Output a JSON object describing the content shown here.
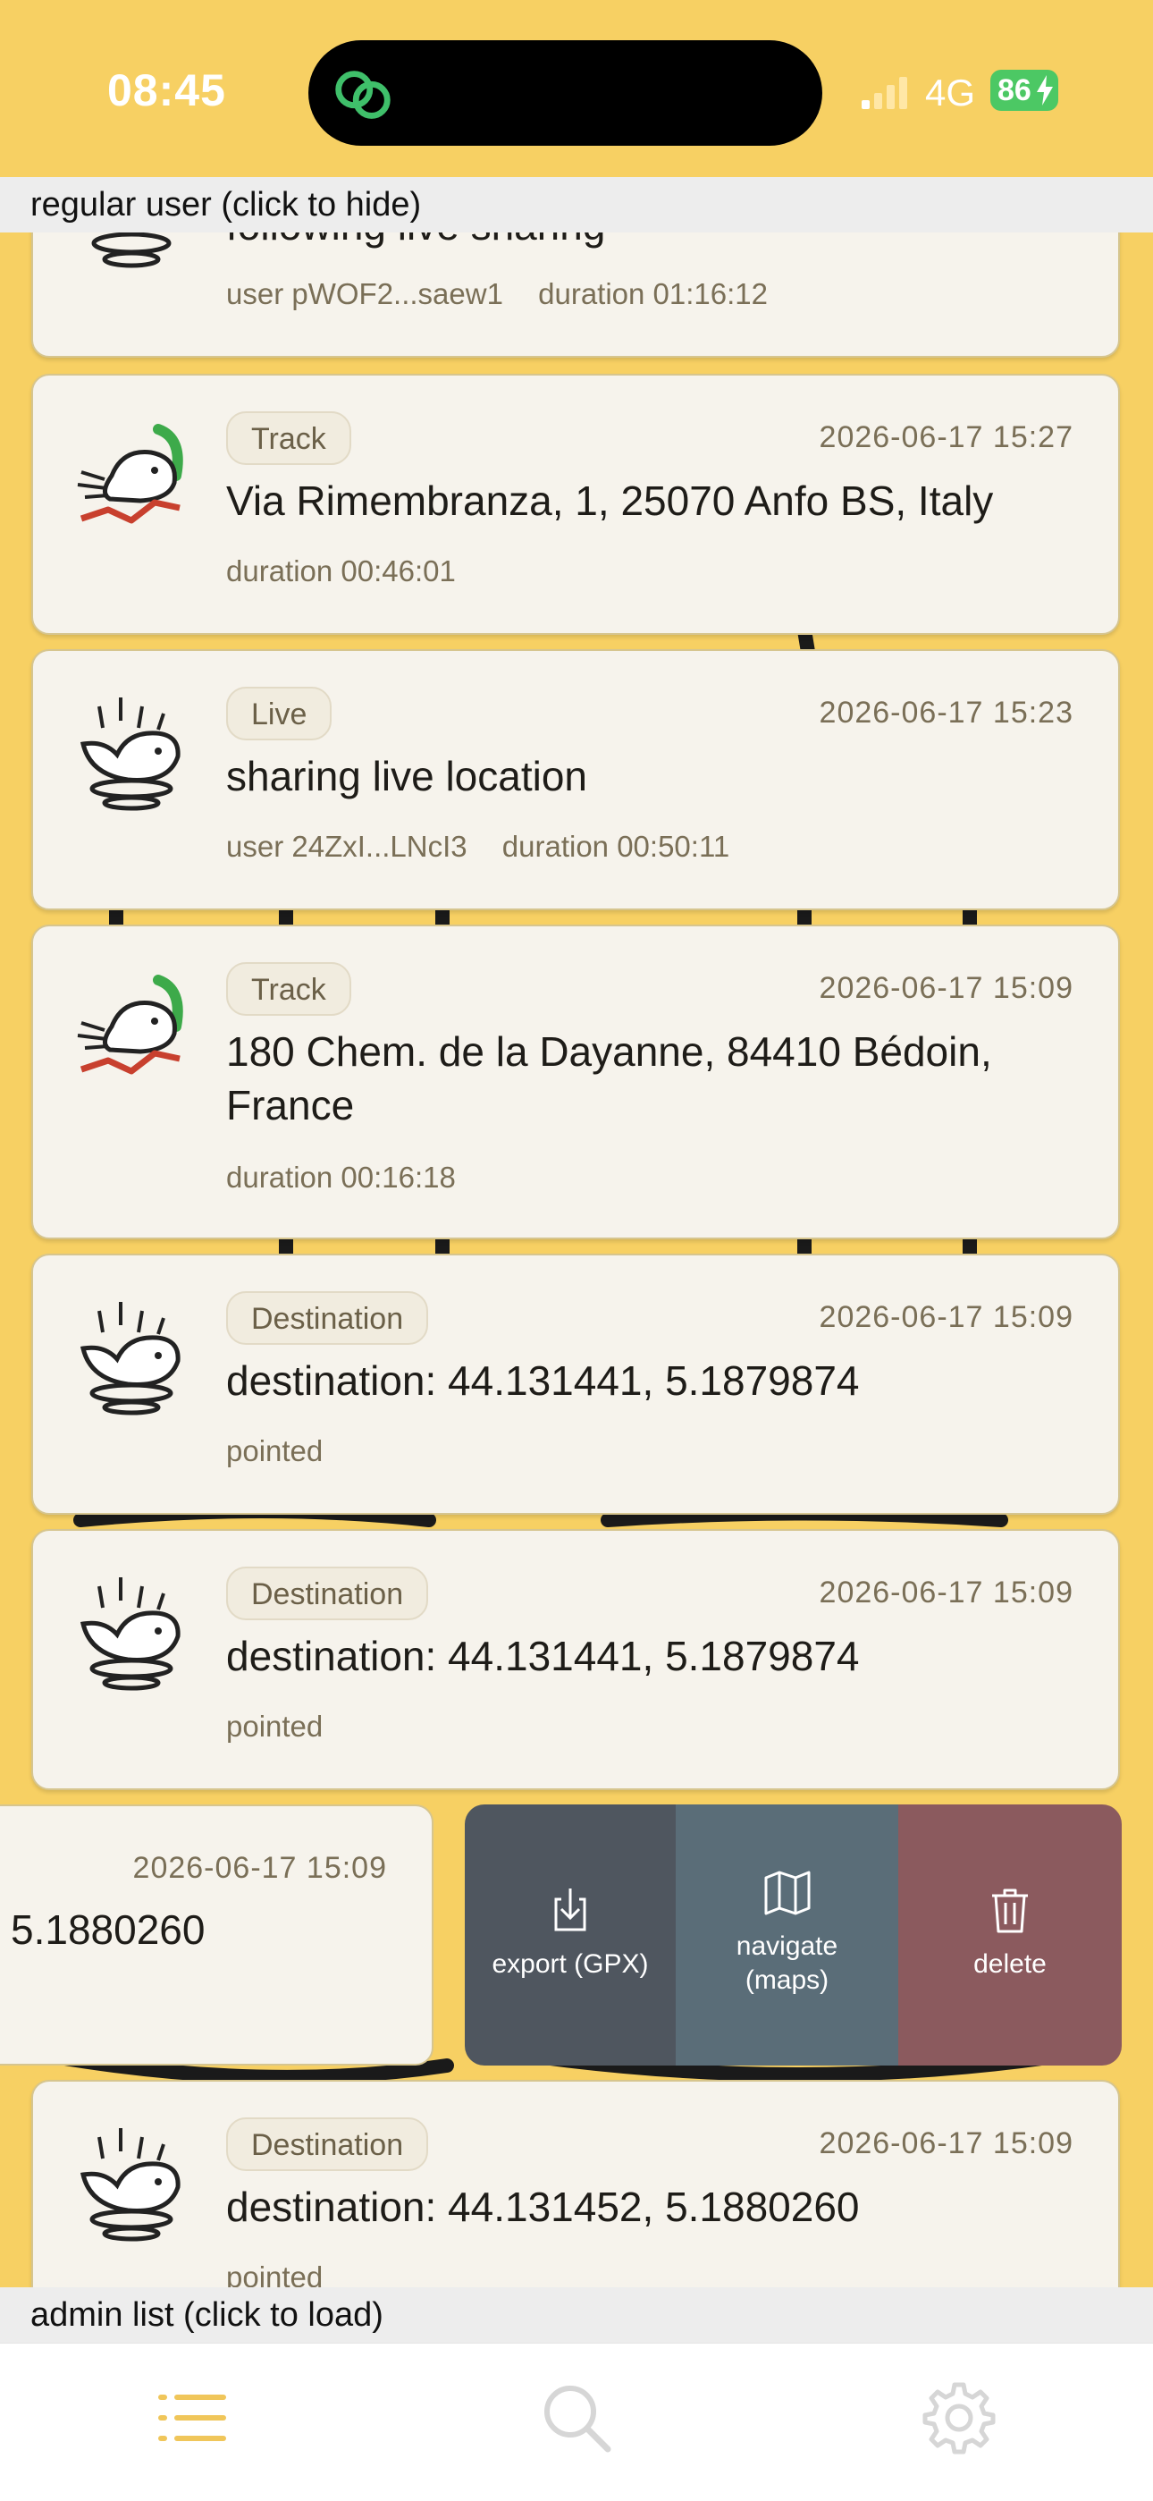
{
  "status_bar": {
    "time": "08:45",
    "network": "4G",
    "battery": "86",
    "island_icon": "link-rings-icon"
  },
  "banners": {
    "top": "regular user (click to hide)",
    "bottom": "admin list (click to load)"
  },
  "items": [
    {
      "type_label": "",
      "date": "",
      "title": "following live sharing",
      "meta": [
        "user pWOF2...saew1",
        "duration 01:16:12"
      ],
      "icon": "whale-splash-icon"
    },
    {
      "type_label": "Track",
      "date": "2026-06-17 15:27",
      "title": "Via Rimembranza, 1, 25070 Anfo BS, Italy",
      "meta": [
        "duration 00:46:01"
      ],
      "icon": "whale-track-icon"
    },
    {
      "type_label": "Live",
      "date": "2026-06-17 15:23",
      "title": "sharing live location",
      "meta": [
        "user 24ZxI...LNcI3",
        "duration 00:50:11"
      ],
      "icon": "whale-splash-icon"
    },
    {
      "type_label": "Track",
      "date": "2026-06-17 15:09",
      "title": "180 Chem. de la Dayanne, 84410 Bédoin, France",
      "meta": [
        "duration 00:16:18"
      ],
      "icon": "whale-track-icon"
    },
    {
      "type_label": "Destination",
      "date": "2026-06-17 15:09",
      "title": "destination: 44.131441, 5.1879874",
      "meta": [
        "pointed"
      ],
      "icon": "whale-splash-icon"
    },
    {
      "type_label": "Destination",
      "date": "2026-06-17 15:09",
      "title": "destination: 44.131441, 5.1879874",
      "meta": [
        "pointed"
      ],
      "icon": "whale-splash-icon"
    },
    {
      "type_label": "",
      "date": "2026-06-17 15:09",
      "title": "5.1880260",
      "meta": [],
      "icon": ""
    },
    {
      "type_label": "Destination",
      "date": "2026-06-17 15:09",
      "title": "destination: 44.131452, 5.1880260",
      "meta": [
        "pointed"
      ],
      "icon": "whale-splash-icon"
    }
  ],
  "swipe_actions": {
    "export": "export (GPX)",
    "navigate": "navigate (maps)",
    "delete": "delete"
  },
  "tabbar": {
    "tabs": [
      "list-icon",
      "search-icon",
      "gear-icon"
    ],
    "active_color": "#f0c65a",
    "inactive_color": "#d6d6d6"
  },
  "colors": {
    "background": "#f7d063",
    "card": "#f6f3ec",
    "export": "#4f565f",
    "navigate": "#5a6d78",
    "delete": "#8b5a5e"
  }
}
